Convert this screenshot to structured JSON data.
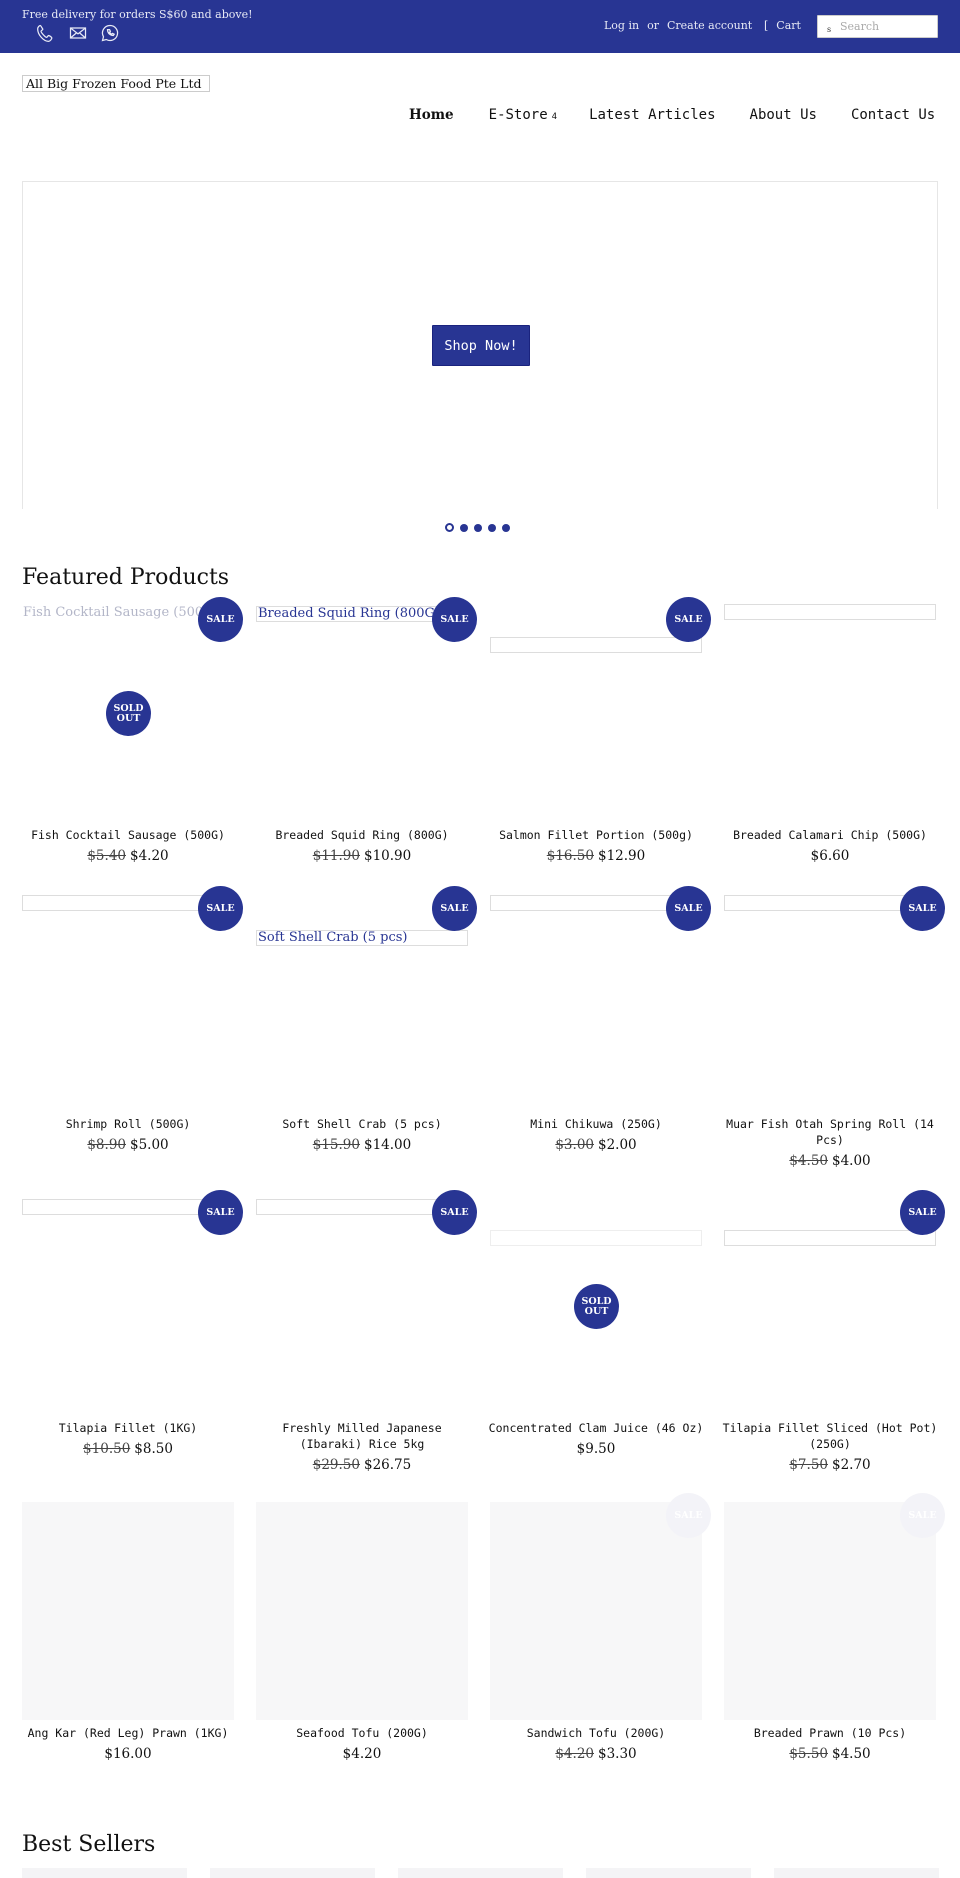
{
  "topbar": {
    "promo": "Free delivery for orders S$60 and above!",
    "icons": [
      "phone-icon",
      "mail-icon",
      "whatsapp-icon"
    ],
    "login": "Log in",
    "or": "or",
    "create_account": "Create account",
    "cart_icon": "[",
    "cart": "Cart",
    "search_icon": "s",
    "search_placeholder": "Search",
    "search_value": ""
  },
  "brand": {
    "logo_text": "All Big Frozen Food Pte Ltd",
    "accent_color": "#283593"
  },
  "nav": {
    "items": [
      {
        "label": "Home"
      },
      {
        "label": "E-Store",
        "caret": "4"
      },
      {
        "label": "Latest Articles"
      },
      {
        "label": "About Us"
      },
      {
        "label": "Contact Us"
      }
    ]
  },
  "hero": {
    "cta": "Shop Now!",
    "slides": 5,
    "active_slide": 1
  },
  "featured": {
    "heading": "Featured Products",
    "products": [
      {
        "alt": "Fish Cocktail Sausage (500G)",
        "name": "Fish Cocktail Sausage (500G)",
        "old_price": "$5.40",
        "price": "$4.20",
        "badges": [
          "SALE",
          "SOLD OUT"
        ]
      },
      {
        "alt": "Breaded Squid Ring (800G)",
        "name": "Breaded Squid Ring (800G)",
        "old_price": "$11.90",
        "price": "$10.90",
        "badges": [
          "SALE"
        ]
      },
      {
        "alt": "",
        "name": "Salmon Fillet Portion (500g)",
        "old_price": "$16.50",
        "price": "$12.90",
        "badges": [
          "SALE"
        ]
      },
      {
        "alt": "",
        "name": "Breaded Calamari Chip (500G)",
        "old_price": "",
        "price": "$6.60",
        "badges": []
      },
      {
        "alt": "",
        "name": "Shrimp Roll (500G)",
        "old_price": "$8.90",
        "price": "$5.00",
        "badges": [
          "SALE"
        ]
      },
      {
        "alt": "Soft Shell Crab (5 pcs)",
        "name": "Soft Shell Crab (5 pcs)",
        "old_price": "$15.90",
        "price": "$14.00",
        "badges": [
          "SALE"
        ]
      },
      {
        "alt": "",
        "name": "Mini Chikuwa (250G)",
        "old_price": "$3.00",
        "price": "$2.00",
        "badges": [
          "SALE"
        ]
      },
      {
        "alt": "",
        "name": "Muar Fish Otah Spring Roll (14 Pcs)",
        "old_price": "$4.50",
        "price": "$4.00",
        "badges": [
          "SALE"
        ]
      },
      {
        "alt": "",
        "name": "Tilapia Fillet (1KG)",
        "old_price": "$10.50",
        "price": "$8.50",
        "badges": [
          "SALE"
        ]
      },
      {
        "alt": "",
        "name": "Freshly Milled Japanese (Ibaraki) Rice 5kg",
        "old_price": "$29.50",
        "price": "$26.75",
        "badges": [
          "SALE"
        ]
      },
      {
        "alt": "",
        "name": "Concentrated Clam Juice (46 Oz)",
        "old_price": "",
        "price": "$9.50",
        "badges": [
          "SOLD OUT"
        ]
      },
      {
        "alt": "",
        "name": "Tilapia Fillet Sliced (Hot Pot) (250G)",
        "old_price": "$7.50",
        "price": "$2.70",
        "badges": [
          "SALE"
        ]
      },
      {
        "alt": "",
        "name": "Ang Kar (Red Leg) Prawn (1KG)",
        "old_price": "",
        "price": "$16.00",
        "badges": []
      },
      {
        "alt": "",
        "name": "Seafood Tofu (200G)",
        "old_price": "",
        "price": "$4.20",
        "badges": []
      },
      {
        "alt": "",
        "name": "Sandwich Tofu (200G)",
        "old_price": "$4.20",
        "price": "$3.30",
        "badges": [
          "SALE"
        ]
      },
      {
        "alt": "",
        "name": "Breaded Prawn (10 Pcs)",
        "old_price": "$5.50",
        "price": "$4.50",
        "badges": [
          "SALE"
        ]
      }
    ]
  },
  "best_sellers": {
    "heading": "Best Sellers"
  }
}
